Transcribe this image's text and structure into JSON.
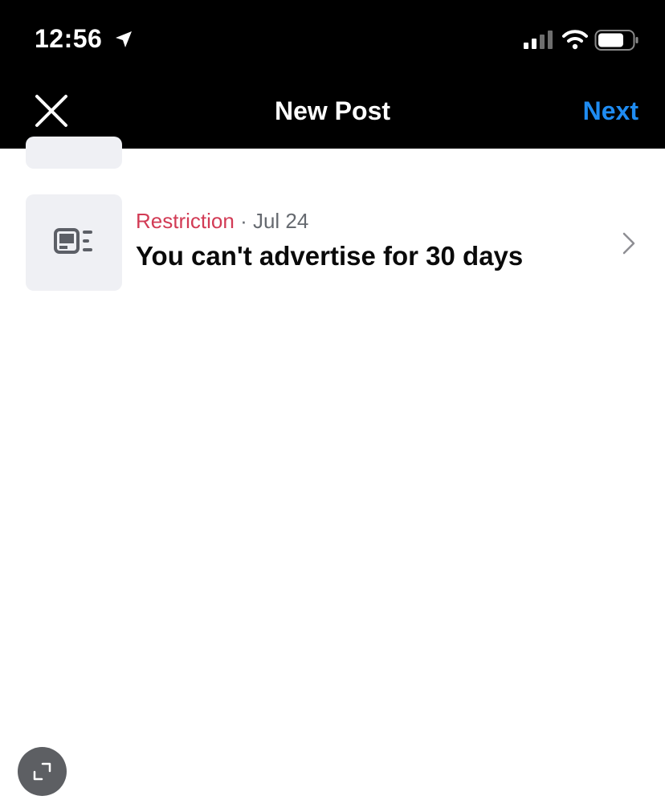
{
  "status_bar": {
    "time": "12:56"
  },
  "nav": {
    "title": "New Post",
    "next_label": "Next"
  },
  "notification": {
    "type": "Restriction",
    "separator": "·",
    "date": "Jul 24",
    "title": "You can't advertise for 30 days"
  },
  "colors": {
    "header_bg": "#000000",
    "accent": "#1f8cf2",
    "restriction": "#d23b55",
    "thumb_bg": "#eff0f4"
  },
  "icons": {
    "close": "close-icon",
    "location": "location-arrow-icon",
    "signal": "cellular-signal-icon",
    "wifi": "wifi-icon",
    "battery": "battery-icon",
    "thumbnail": "ad-placeholder-icon",
    "chevron": "chevron-right-icon",
    "expand": "expand-icon"
  }
}
